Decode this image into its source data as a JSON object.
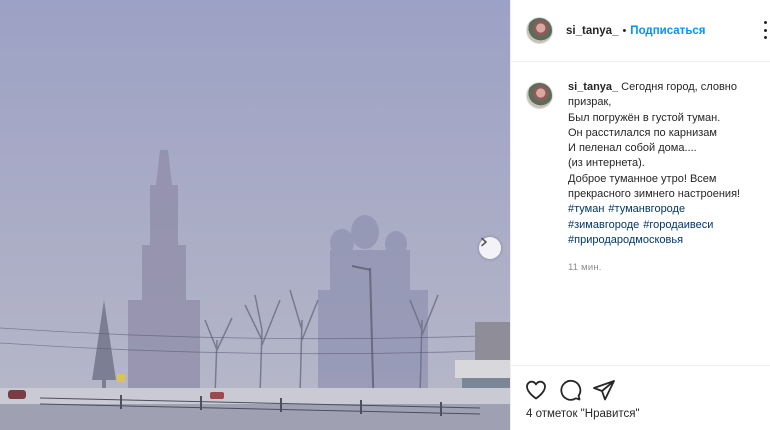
{
  "post": {
    "username": "si_tanya_",
    "follow_label": "Подписаться",
    "separator": "•",
    "caption_lines": [
      "Сегодня город, словно",
      "призрак,",
      "Был погружён в густой туман.",
      "Он расстилался по карнизам",
      "И пеленал собой дома....",
      "(из интернета).",
      "Доброе туманное утро! Всем",
      "прекрасного зимнего настроения!"
    ],
    "hashtags": [
      [
        "#туман",
        "#туманвгороде"
      ],
      [
        "#зимавгороде",
        "#городаивеси"
      ],
      [
        "#природародмосковья"
      ]
    ],
    "timestamp": "11 мин.",
    "likes_text": "4 отметок \"Нравится\""
  },
  "icons": {
    "next": "chevron-right-icon",
    "more": "more-horizontal-icon",
    "like": "heart-icon",
    "comment": "comment-icon",
    "share": "paper-plane-icon"
  }
}
